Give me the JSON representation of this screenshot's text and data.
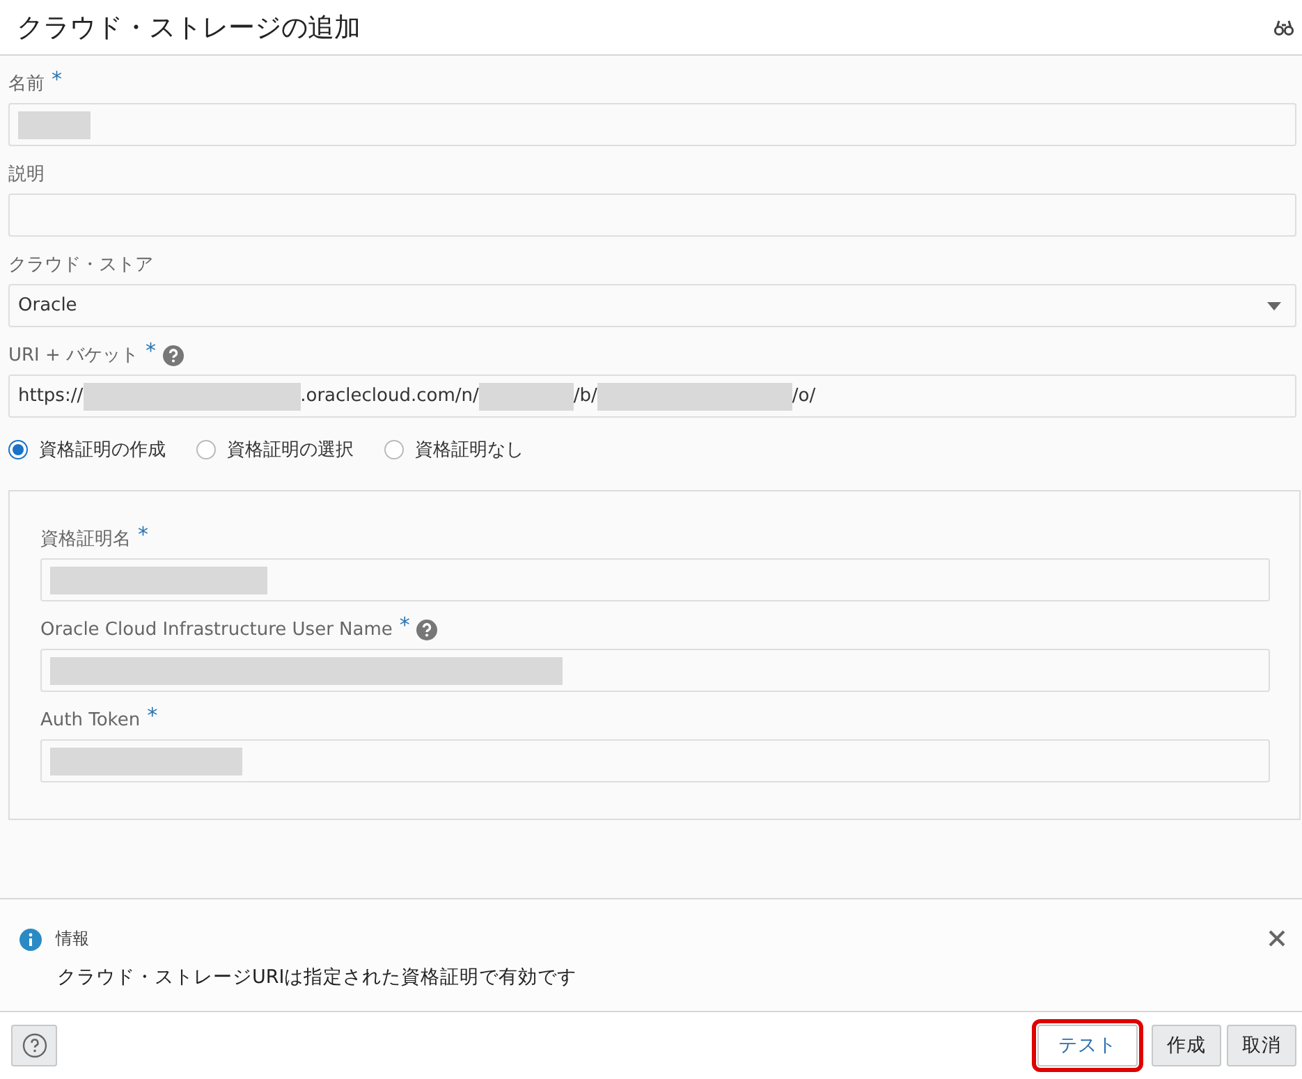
{
  "window": {
    "title": "クラウド・ストレージの追加"
  },
  "fields": [
    {
      "kind": "text",
      "label": "名前",
      "required_mark": "*",
      "segments": [
        {
          "kind": "redacted"
        }
      ]
    },
    {
      "kind": "text",
      "label": "説明"
    },
    {
      "kind": "select",
      "label": "クラウド・ストア",
      "segments": [
        {
          "kind": "text",
          "text": "Oracle"
        }
      ]
    },
    {
      "kind": "text",
      "label": "URI + バケット",
      "required_mark": "*",
      "help": true,
      "segments": [
        {
          "kind": "text",
          "text": "https://"
        },
        {
          "kind": "redacted"
        },
        {
          "kind": "text",
          "text": ".oraclecloud.com/n/"
        },
        {
          "kind": "redacted"
        },
        {
          "kind": "text",
          "text": "/b/"
        },
        {
          "kind": "redacted"
        },
        {
          "kind": "text",
          "text": "/o/"
        }
      ]
    }
  ],
  "credential_options": [
    {
      "label": "資格証明の作成",
      "selected": true
    },
    {
      "label": "資格証明の選択",
      "selected": false
    },
    {
      "label": "資格証明なし",
      "selected": false
    }
  ],
  "credential_fields": [
    {
      "kind": "text",
      "label": "資格証明名",
      "required_mark": "*",
      "segments": [
        {
          "kind": "redacted"
        }
      ]
    },
    {
      "kind": "text",
      "label": "Oracle Cloud Infrastructure User Name",
      "required_mark": "*",
      "help": true,
      "segments": [
        {
          "kind": "redacted"
        }
      ]
    },
    {
      "kind": "text",
      "label": "Auth Token",
      "required_mark": "*",
      "segments": [
        {
          "kind": "redacted"
        }
      ]
    }
  ],
  "message": {
    "title": "情報",
    "text": "クラウド・ストレージURIは指定された資格証明で有効です"
  },
  "buttons": [
    {
      "label": "テスト",
      "highlighted": true
    },
    {
      "label": "作成",
      "highlighted": false
    },
    {
      "label": "取消",
      "highlighted": false
    }
  ]
}
